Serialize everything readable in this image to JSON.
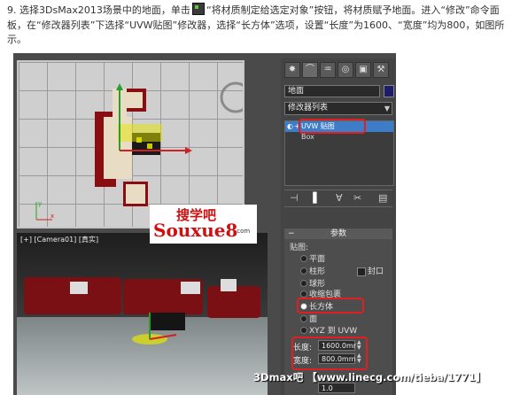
{
  "article": {
    "text_before_icon": "9. 选择3DsMax2013场景中的地面，单击",
    "text_after_icon": "“将材质制定给选定对象”按钮，将材质赋予地面。进入“修改”命令面板，在“修改器列表”下选择“UVW贴图”修改器，选择“长方体”选项，设置“长度”为1600、“宽度”均为800，如图所示。"
  },
  "viewport_top": {
    "axis_x": "x",
    "axis_y": "y"
  },
  "viewport_camera": {
    "label": "[+] [Camera01] [真实]"
  },
  "panel": {
    "object_name": "地面",
    "modifier_list": "修改器列表",
    "stack_items": [
      "UVW 贴图",
      "Box"
    ],
    "params_title": "参数",
    "mapping_label": "贴图:",
    "options": [
      "平面",
      "柱形",
      "球形",
      "收缩包裹",
      "长方体",
      "面",
      "XYZ 到 UVW"
    ],
    "cap_label": "封口",
    "selected_option": "长方体",
    "length_label": "长度:",
    "length_value": "1600.0mr",
    "width_label": "宽度:",
    "width_value": "800.0mm",
    "bottom_value": "1.0"
  },
  "watermark": {
    "line1": "搜学吧",
    "line2": "Souxue8",
    "suffix": ".com"
  },
  "footer": {
    "text": "3Dmax吧 【www.linecg.com/tieba/1771】"
  },
  "colors": {
    "accent_red": "#e02020",
    "selection_blue": "#3d7cc9",
    "model_red": "#8a0d12"
  }
}
